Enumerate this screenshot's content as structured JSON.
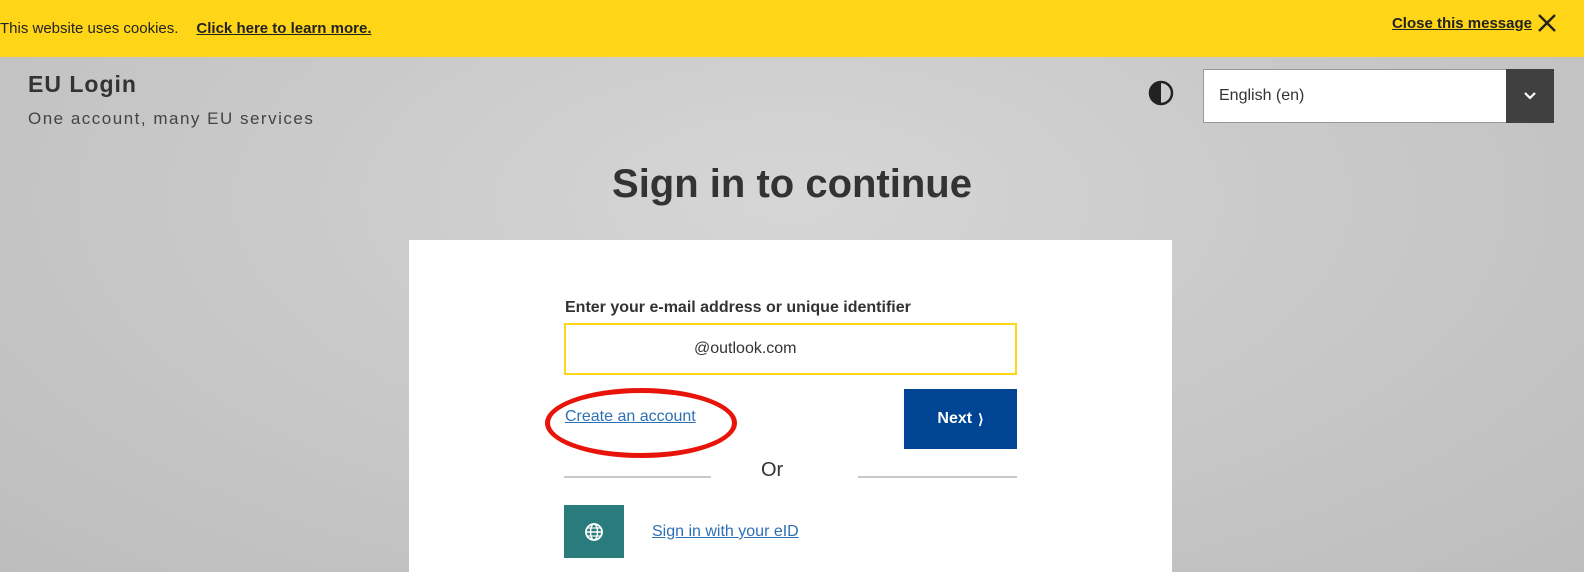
{
  "cookie_bar": {
    "message": "This website uses cookies.",
    "learn_more": "Click here to learn more.",
    "close_label": "Close this message"
  },
  "header": {
    "title": "EU Login",
    "subtitle": "One account, many EU services",
    "language": "English (en)"
  },
  "main": {
    "heading": "Sign in to continue",
    "field_label": "Enter your e-mail address or unique identifier",
    "field_value": "@outlook.com",
    "create_account": "Create an account",
    "next_label": "Next",
    "or_text": "Or",
    "eid_link": "Sign in with your eID"
  },
  "icons": {
    "close": "close-icon",
    "contrast": "contrast-icon",
    "dropdown": "chevron-down-icon",
    "next": "chevron-right-icon",
    "eid": "globe-icon"
  },
  "colors": {
    "cookie_bar": "#ffd617",
    "primary_button": "#004494",
    "link": "#2e6fb5",
    "eid_button": "#2a7b7b",
    "highlight_ring": "#e8140a"
  }
}
